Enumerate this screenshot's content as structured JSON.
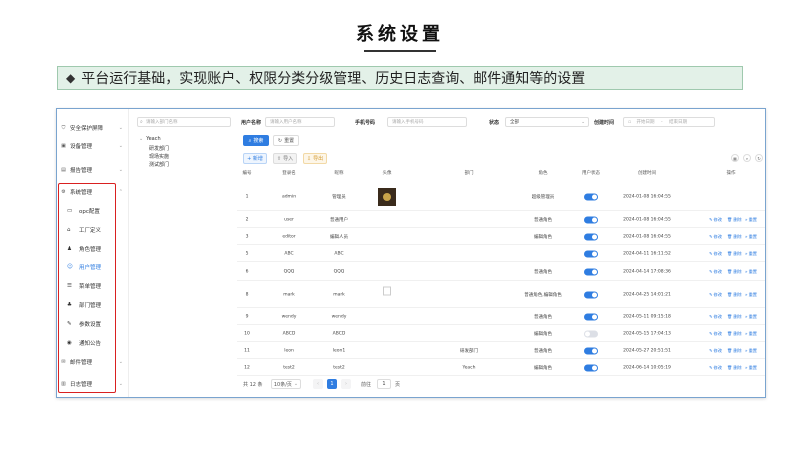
{
  "slide": {
    "title": "系统设置",
    "banner_bullet": "◆",
    "banner_text": "平台运行基础，实现账户、权限分类分级管理、历史日志查询、邮件通知等的设置"
  },
  "sidebar": {
    "top_items": [
      {
        "label": "安全保护屏障",
        "icon": "shield-icon"
      },
      {
        "label": "设备管理",
        "icon": "device-icon"
      },
      {
        "label": "报告管理",
        "icon": "report-icon"
      }
    ],
    "system": {
      "label": "系统管理",
      "icon": "gear-icon"
    },
    "sub_items": [
      {
        "label": "opc配置",
        "icon": "opc-icon"
      },
      {
        "label": "工厂定义",
        "icon": "factory-icon"
      },
      {
        "label": "角色管理",
        "icon": "role-icon"
      },
      {
        "label": "用户管理",
        "icon": "user-icon",
        "active": true
      },
      {
        "label": "菜单管理",
        "icon": "menu-icon"
      },
      {
        "label": "部门管理",
        "icon": "dept-icon"
      },
      {
        "label": "参数设置",
        "icon": "param-icon"
      },
      {
        "label": "通知公告",
        "icon": "notice-icon"
      }
    ],
    "bottom_items": [
      {
        "label": "邮件管理",
        "icon": "mail-icon"
      },
      {
        "label": "日志管理",
        "icon": "log-icon"
      }
    ]
  },
  "tree": {
    "search_placeholder": "请输入部门名称",
    "root": "Yeach",
    "children": [
      "研发部门",
      "现场实施",
      "测试部门"
    ]
  },
  "filters": {
    "username_label": "用户名称",
    "username_placeholder": "请输入用户名称",
    "phone_label": "手机号码",
    "phone_placeholder": "请输入手机号码",
    "status_label": "状态",
    "status_value": "全部",
    "time_label": "创建时间",
    "start_placeholder": "开始日期",
    "dash": "-",
    "end_placeholder": "结束日期",
    "search_btn": "搜索",
    "reset_btn": "重置"
  },
  "toolbar": {
    "add": "+ 新增",
    "import": "导入",
    "export": "导出"
  },
  "table": {
    "headers": [
      "编号",
      "登录名",
      "昵称",
      "头像",
      "部门",
      "角色",
      "用户状态",
      "创建时间",
      "操作"
    ],
    "rows": [
      {
        "id": "1",
        "login": "admin",
        "nick": "管理员",
        "dept": "",
        "role": "超级管理员",
        "on": true,
        "time": "2024-01-08 16:04:55",
        "avatar": "img",
        "ops": false
      },
      {
        "id": "2",
        "login": "user",
        "nick": "普通用户",
        "dept": "",
        "role": "普通角色",
        "on": true,
        "time": "2024-01-08 16:04:55",
        "avatar": "",
        "ops": true
      },
      {
        "id": "3",
        "login": "editor",
        "nick": "编辑人员",
        "dept": "",
        "role": "编辑角色",
        "on": true,
        "time": "2024-01-08 16:04:55",
        "avatar": "",
        "ops": true
      },
      {
        "id": "5",
        "login": "ABC",
        "nick": "ABC",
        "dept": "",
        "role": "",
        "on": true,
        "time": "2024-04-11 16:11:52",
        "avatar": "",
        "ops": true
      },
      {
        "id": "6",
        "login": "QQQ",
        "nick": "QQQ",
        "dept": "",
        "role": "普通角色",
        "on": true,
        "time": "2024-04-14 17:08:36",
        "avatar": "",
        "ops": true
      },
      {
        "id": "8",
        "login": "mark",
        "nick": "mark",
        "dept": "",
        "role": "普通角色,编辑角色",
        "on": true,
        "time": "2024-04-25 14:01:21",
        "avatar": "ph",
        "ops": true
      },
      {
        "id": "9",
        "login": "wendy",
        "nick": "wendy",
        "dept": "",
        "role": "普通角色",
        "on": true,
        "time": "2024-05-11 09:15:18",
        "avatar": "",
        "ops": true
      },
      {
        "id": "10",
        "login": "ABCD",
        "nick": "ABCD",
        "dept": "",
        "role": "编辑角色",
        "on": false,
        "time": "2024-05-15 17:04:13",
        "avatar": "",
        "ops": true
      },
      {
        "id": "11",
        "login": "leon",
        "nick": "leon1",
        "dept": "研发部门",
        "role": "普通角色",
        "on": true,
        "time": "2024-05-27 20:51:51",
        "avatar": "",
        "ops": true
      },
      {
        "id": "12",
        "login": "test2",
        "nick": "test2",
        "dept": "Yeach",
        "role": "编辑角色",
        "on": true,
        "time": "2024-06-14 10:05:19",
        "avatar": "",
        "ops": true
      }
    ],
    "op_edit": "修改",
    "op_delete": "删除",
    "op_reset": "重置"
  },
  "pager": {
    "total": "共 12 条",
    "page_size": "10条/页",
    "current": "1",
    "goto": "前往",
    "goto_value": "1",
    "page_unit": "页"
  }
}
